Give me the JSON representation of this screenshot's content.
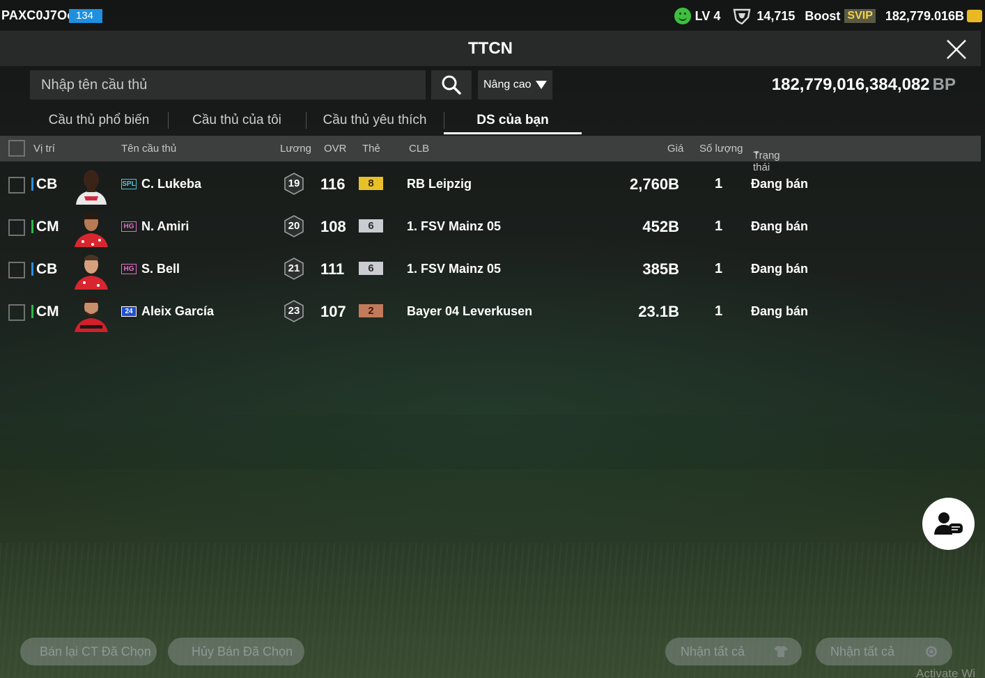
{
  "top": {
    "player_id": "PAXC0J7Oo",
    "player_level": "134",
    "lv": "LV 4",
    "points": "14,715",
    "boost": "Boost",
    "svip": "SVIP",
    "balance": "182,779.016B"
  },
  "header": {
    "title": "TTCN"
  },
  "search": {
    "placeholder": "Nhập tên cầu thủ",
    "advanced": "Nâng cao",
    "bp_amount": "182,779,016,384,082",
    "bp_unit": "BP"
  },
  "tabs": [
    {
      "label": "Cầu thủ phổ biến"
    },
    {
      "label": "Cầu thủ của tôi"
    },
    {
      "label": "Cầu thủ yêu thích"
    },
    {
      "label": "DS của bạn"
    }
  ],
  "columns": {
    "position": "Vị trí",
    "name": "Tên cầu thủ",
    "salary": "Lương",
    "ovr": "OVR",
    "card": "Thẻ",
    "club": "CLB",
    "price": "Giá",
    "qty": "Số lượng",
    "status": "Trạng thái"
  },
  "rows": [
    {
      "position": "CB",
      "season": "SPL",
      "name": "C. Lukeba",
      "salary": "19",
      "ovr": "116",
      "upgrade": "8",
      "club": "RB Leipzig",
      "price": "2,760B",
      "qty": "1",
      "status": "Đang bán"
    },
    {
      "position": "CM",
      "season": "HG",
      "name": "N. Amiri",
      "salary": "20",
      "ovr": "108",
      "upgrade": "6",
      "club": "1. FSV Mainz 05",
      "price": "452B",
      "qty": "1",
      "status": "Đang bán"
    },
    {
      "position": "CB",
      "season": "HG",
      "name": "S. Bell",
      "salary": "21",
      "ovr": "111",
      "upgrade": "6",
      "club": "1. FSV Mainz 05",
      "price": "385B",
      "qty": "1",
      "status": "Đang bán"
    },
    {
      "position": "CM",
      "season": "24",
      "name": "Aleix García",
      "salary": "23",
      "ovr": "107",
      "upgrade": "2",
      "club": "Bayer 04 Leverkusen",
      "price": "23.1B",
      "qty": "1",
      "status": "Đang bán"
    }
  ],
  "bottom": {
    "resell": "Bán lại CT Đã Chọn",
    "cancel": "Hủy Bán Đã Chọn",
    "claim_all_1": "Nhận tất cả",
    "claim_all_2": "Nhận tất cả"
  },
  "watermark": "Activate Wi",
  "colors": {
    "position_def": "#2b8fe0",
    "position_mid": "#2fb84a",
    "upgrade_gold": "#e8c12a",
    "upgrade_silver": "#c9ccd0",
    "upgrade_bronze": "#c27a5a"
  }
}
